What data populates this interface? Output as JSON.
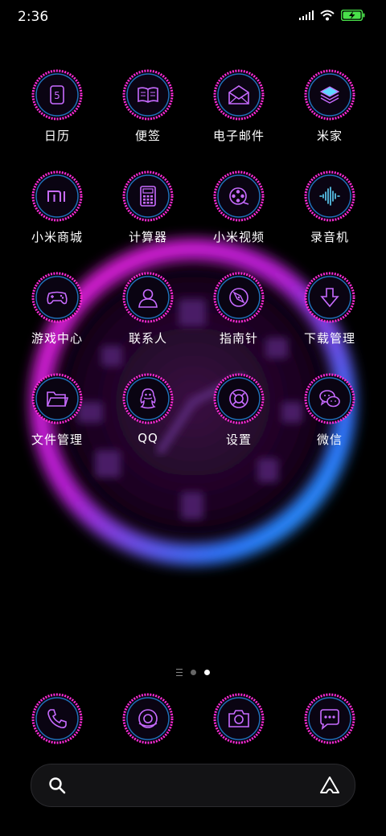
{
  "status_bar": {
    "time": "2:36"
  },
  "apps": [
    {
      "label": "日历",
      "icon": "calendar-icon"
    },
    {
      "label": "便签",
      "icon": "notes-icon"
    },
    {
      "label": "电子邮件",
      "icon": "email-icon"
    },
    {
      "label": "米家",
      "icon": "mijia-icon"
    },
    {
      "label": "小米商城",
      "icon": "mi-store-icon"
    },
    {
      "label": "计算器",
      "icon": "calculator-icon"
    },
    {
      "label": "小米视频",
      "icon": "video-icon"
    },
    {
      "label": "录音机",
      "icon": "recorder-icon"
    },
    {
      "label": "游戏中心",
      "icon": "gamepad-icon"
    },
    {
      "label": "联系人",
      "icon": "contacts-icon"
    },
    {
      "label": "指南针",
      "icon": "compass-icon"
    },
    {
      "label": "下载管理",
      "icon": "download-icon"
    },
    {
      "label": "文件管理",
      "icon": "folder-icon"
    },
    {
      "label": "QQ",
      "icon": "qq-icon"
    },
    {
      "label": "设置",
      "icon": "settings-icon"
    },
    {
      "label": "微信",
      "icon": "wechat-icon"
    }
  ],
  "calendar_day": "5",
  "dock": [
    {
      "icon": "phone-icon"
    },
    {
      "icon": "browser-icon"
    },
    {
      "icon": "camera-icon"
    },
    {
      "icon": "messages-icon"
    }
  ],
  "pager": {
    "pages": 2,
    "active": 2
  },
  "search": {
    "placeholder": ""
  },
  "colors": {
    "ring_pink": "#ff2bd6",
    "ring_blue": "#2a9dff",
    "icon_stroke": "#c86bff",
    "bg": "#000000"
  }
}
